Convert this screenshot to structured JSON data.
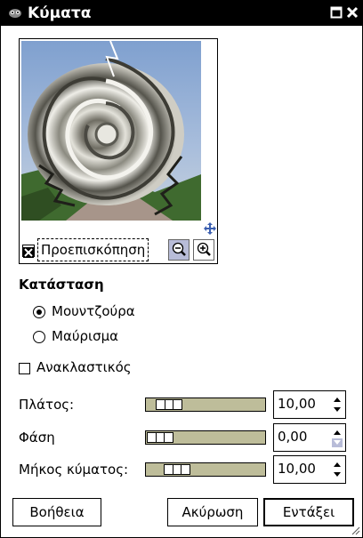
{
  "window": {
    "title": "Κύματα"
  },
  "preview": {
    "label": "Προεπισκόπηση",
    "checked": true
  },
  "mode": {
    "title": "Κατάσταση",
    "options": [
      {
        "label": "Μουντζούρα",
        "selected": true
      },
      {
        "label": "Μαύρισμα",
        "selected": false
      }
    ]
  },
  "reflective": {
    "label": "Ανακλαστικός",
    "checked": false
  },
  "params": [
    {
      "label": "Πλάτος:",
      "value": "10,00",
      "level": 0.1
    },
    {
      "label": "Φάση",
      "value": "0,00",
      "level": 0.0
    },
    {
      "label": "Μήκος κύματος:",
      "value": "10,00",
      "level": 0.2
    }
  ],
  "buttons": {
    "help": "Βοήθεια",
    "cancel": "Ακύρωση",
    "ok": "Εντάξει"
  },
  "colors": {
    "slider_trough": "#bebd9a",
    "zoom_active": "#b8bcd8"
  }
}
